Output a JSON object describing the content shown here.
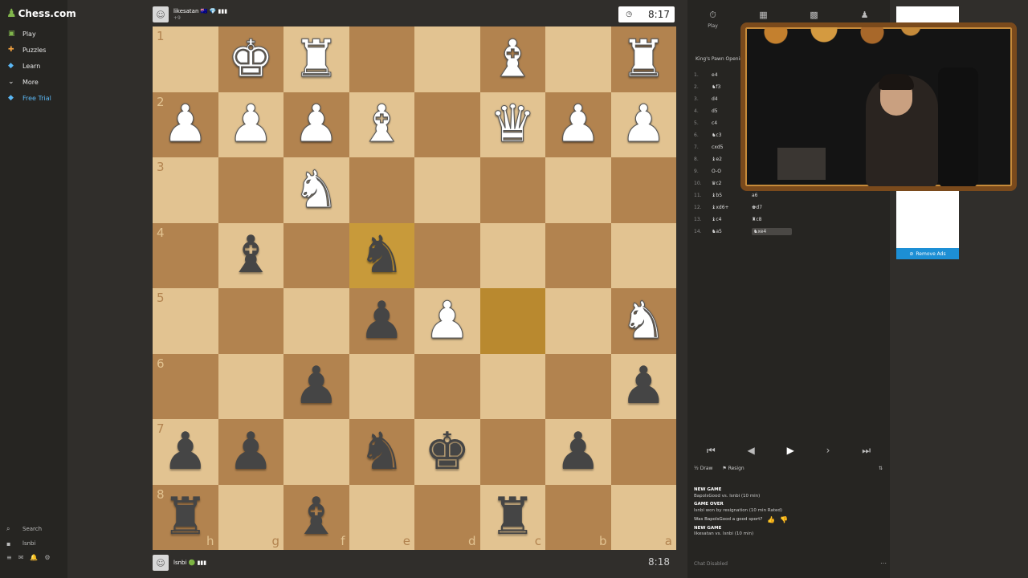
{
  "sidebar": {
    "logo_text": "Chess.com",
    "items": [
      {
        "label": "Play",
        "icon": "play-icon"
      },
      {
        "label": "Puzzles",
        "icon": "puzzle-icon"
      },
      {
        "label": "Learn",
        "icon": "learn-icon"
      },
      {
        "label": "More",
        "icon": "chevron-down-icon"
      },
      {
        "label": "Free Trial",
        "icon": "diamond-icon"
      }
    ],
    "search_label": "Search",
    "user_label": "lsnbi"
  },
  "top_player": {
    "name": "likesatan 🇦🇺 💎 ▮▮▮",
    "sub": "+9",
    "clock": "8:17"
  },
  "bottom_player": {
    "name": "lsnbi 🟢 ▮▮▮",
    "clock": "8:18"
  },
  "board": {
    "ranks": [
      "1",
      "2",
      "3",
      "4",
      "5",
      "6",
      "7",
      "8"
    ],
    "files": [
      "h",
      "g",
      "f",
      "e",
      "d",
      "c",
      "b",
      "a"
    ],
    "rows": [
      [
        "",
        "wK",
        "wR",
        "",
        "",
        "wB",
        "",
        "wR"
      ],
      [
        "wP",
        "wP",
        "wP",
        "wB",
        "",
        "wQ",
        "wP",
        "wP"
      ],
      [
        "",
        "",
        "wN",
        "",
        "",
        "",
        "",
        ""
      ],
      [
        "",
        "bB",
        "",
        "bN",
        "",
        "",
        "",
        ""
      ],
      [
        "",
        "",
        "",
        "bP",
        "wP",
        "",
        "",
        "wN"
      ],
      [
        "",
        "",
        "bP",
        "",
        "",
        "",
        "",
        "bP"
      ],
      [
        "bP",
        "bP",
        "",
        "bN",
        "bK",
        "",
        "bP",
        ""
      ],
      [
        "bR",
        "",
        "bB",
        "",
        "",
        "bR",
        "",
        ""
      ]
    ],
    "highlights": [
      "3-3",
      "4-5"
    ]
  },
  "panel": {
    "tabs": [
      {
        "label": "Play",
        "icon": "clock-icon"
      },
      {
        "label": "",
        "icon": "board-icon"
      },
      {
        "label": "",
        "icon": "grid-icon"
      },
      {
        "label": "",
        "icon": "friends-icon"
      }
    ],
    "opening": "King's Pawn Openin",
    "moves": [
      {
        "n": "1.",
        "w": "e4",
        "b": ""
      },
      {
        "n": "2.",
        "w": "♞f3",
        "b": ""
      },
      {
        "n": "3.",
        "w": "d4",
        "b": ""
      },
      {
        "n": "4.",
        "w": "d5",
        "b": ""
      },
      {
        "n": "5.",
        "w": "c4",
        "b": ""
      },
      {
        "n": "6.",
        "w": "♞c3",
        "b": ""
      },
      {
        "n": "7.",
        "w": "cxd5",
        "b": ""
      },
      {
        "n": "8.",
        "w": "♝e2",
        "b": ""
      },
      {
        "n": "9.",
        "w": "O-O",
        "b": ""
      },
      {
        "n": "10.",
        "w": "♛c2",
        "b": ""
      },
      {
        "n": "11.",
        "w": "♝b5",
        "b": "a6"
      },
      {
        "n": "12.",
        "w": "♝xd6+",
        "b": "♚d7"
      },
      {
        "n": "13.",
        "w": "♝c4",
        "b": "♜c8"
      },
      {
        "n": "14.",
        "w": "♞a5",
        "b": "♞xe4"
      }
    ],
    "actions": {
      "draw": "Draw",
      "resign": "Resign"
    },
    "chat": [
      {
        "type": "header",
        "text": "NEW GAME"
      },
      {
        "type": "line",
        "text": "BapolsGood vs. lsnbi (10 min)"
      },
      {
        "type": "header",
        "text": "GAME OVER"
      },
      {
        "type": "line",
        "text": "lsnbi won by resignation (10 min Rated)"
      },
      {
        "type": "rate",
        "text": "Was BapolsGood a good sport?"
      },
      {
        "type": "header",
        "text": "NEW GAME"
      },
      {
        "type": "line",
        "text": "likesatan vs. lsnbi (10 min)"
      }
    ],
    "chat_disabled": "Chat Disabled"
  },
  "ad": {
    "remove_label": "Remove Ads"
  }
}
